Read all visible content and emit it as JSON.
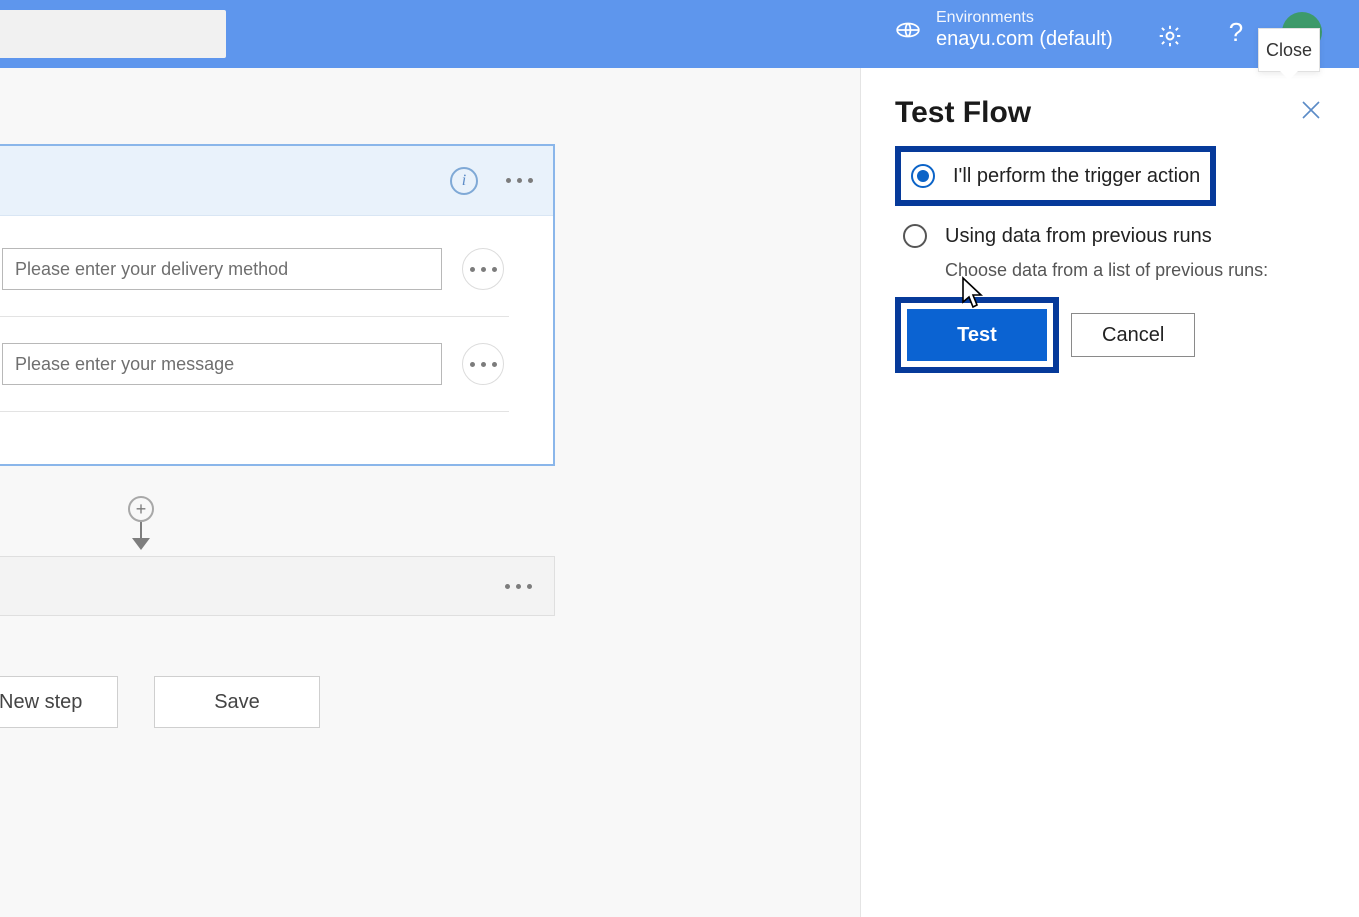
{
  "header": {
    "env_label": "Environments",
    "env_name": "enayu.com (default)",
    "close_tooltip": "Close"
  },
  "trigger": {
    "inputs": [
      {
        "placeholder": "Please enter your delivery method"
      },
      {
        "placeholder": "Please enter your message"
      }
    ]
  },
  "bottom": {
    "new_step": "New step",
    "save": "Save"
  },
  "panel": {
    "title": "Test Flow",
    "option_perform": "I'll perform the trigger action",
    "option_previous": "Using data from previous runs",
    "previous_desc": "Choose data from a list of previous runs:",
    "test_btn": "Test",
    "cancel_btn": "Cancel"
  }
}
